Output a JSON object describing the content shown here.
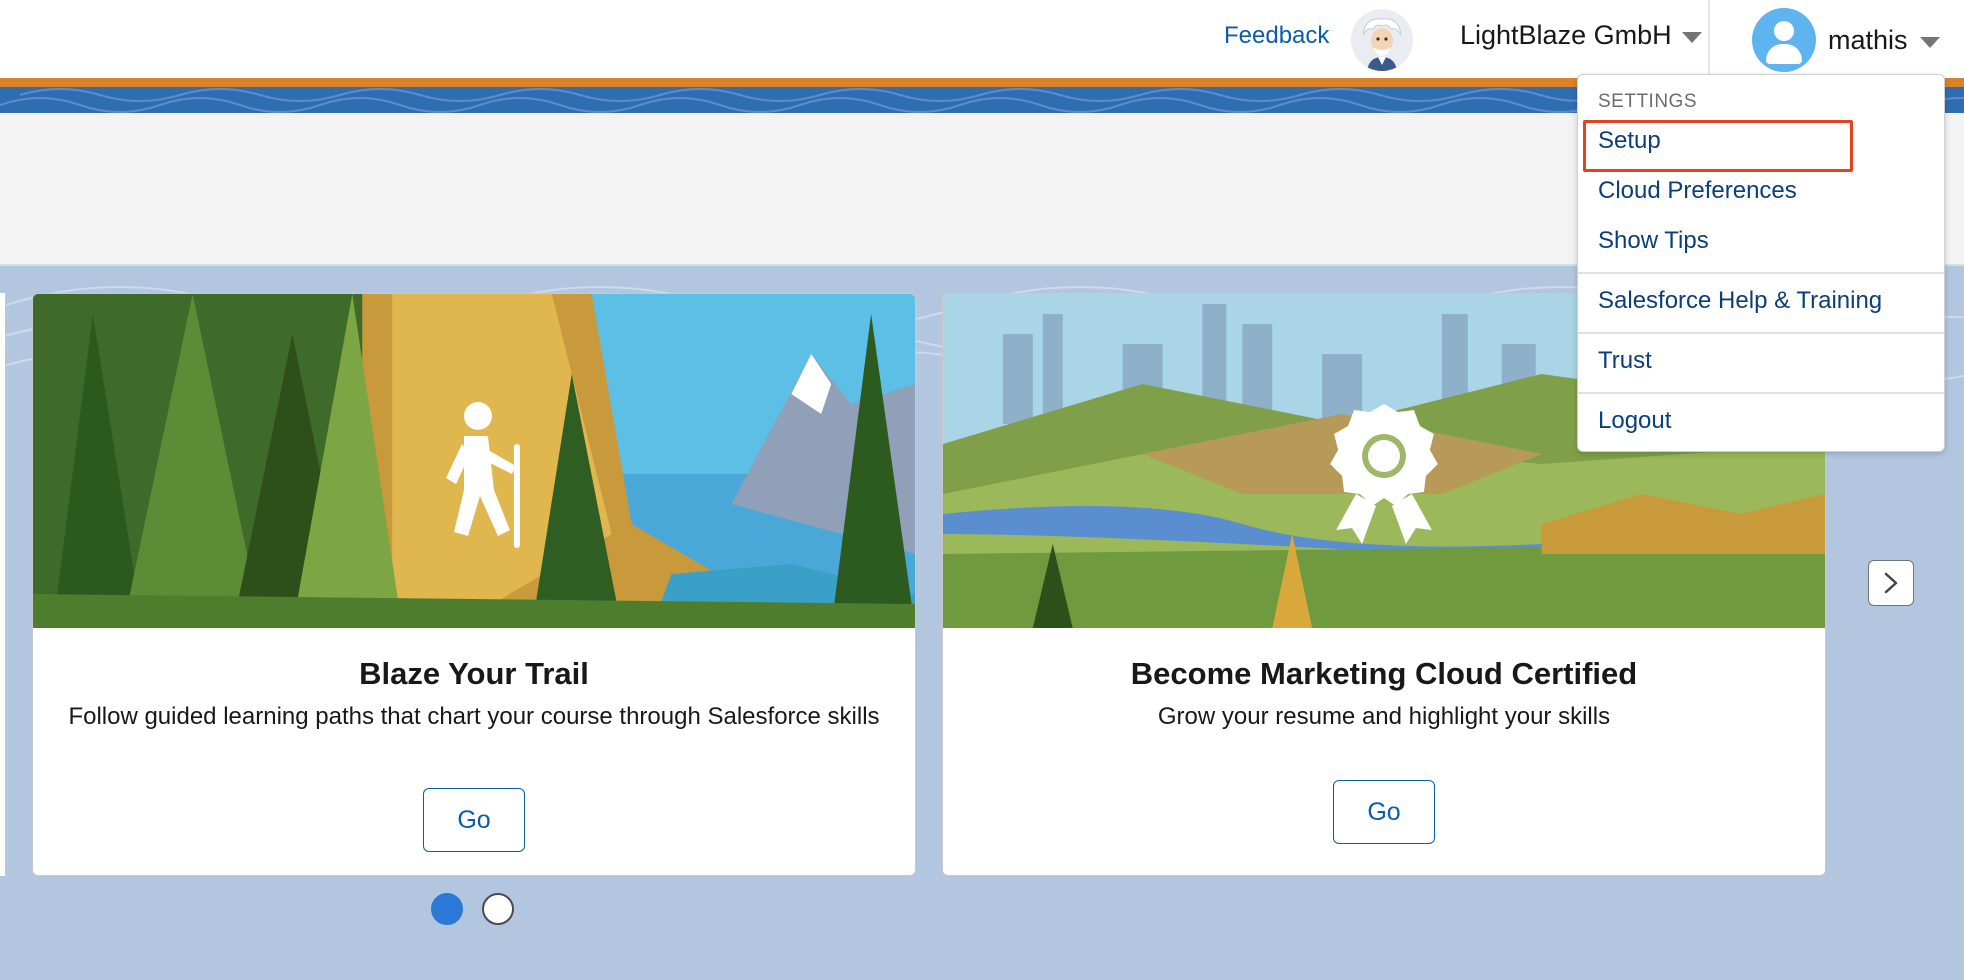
{
  "header": {
    "feedback": "Feedback",
    "org_name": "LightBlaze GmbH",
    "user_name": "mathis"
  },
  "user_menu": {
    "section": "SETTINGS",
    "items": [
      "Setup",
      "Cloud Preferences",
      "Show Tips",
      "Salesforce Help & Training",
      "Trust",
      "Logout"
    ],
    "highlighted": "Setup"
  },
  "cards": [
    {
      "title": "Blaze Your Trail",
      "description": "Follow guided learning paths that chart your course through Salesforce skills",
      "button": "Go",
      "icon": "hiker-icon"
    },
    {
      "title": "Become Marketing Cloud Certified",
      "description": "Grow your resume and highlight your skills",
      "button": "Go",
      "icon": "certification-badge-icon"
    }
  ],
  "carousel": {
    "pages": 2,
    "active_page": 1
  },
  "colors": {
    "brand_blue": "#0b5cab",
    "accent_orange": "#d8822b",
    "highlight_red": "#e0451f",
    "dot_active": "#2b78d6"
  }
}
